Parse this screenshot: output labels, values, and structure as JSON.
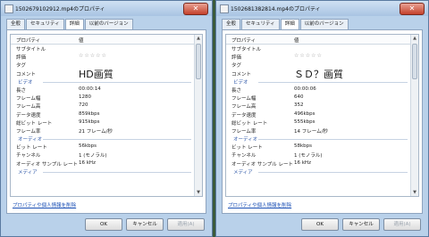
{
  "left_window": {
    "title": "1502679102912.mp4のプロパティ",
    "tabs": [
      "全般",
      "セキュリティ",
      "詳細",
      "以前のバージョン"
    ],
    "active_tab": 2,
    "header": {
      "prop": "プロパティ",
      "value": "値"
    },
    "desc_rows": [
      {
        "key": "サブタイトル",
        "value": ""
      },
      {
        "key": "評価",
        "value": "☆☆☆☆☆"
      },
      {
        "key": "タグ",
        "value": ""
      },
      {
        "key": "コメント",
        "value": "HD画質"
      }
    ],
    "video_section": "ビデオ",
    "video_rows": [
      {
        "key": "長さ",
        "value": "00:00:14"
      },
      {
        "key": "フレーム幅",
        "value": "1280"
      },
      {
        "key": "フレーム高",
        "value": "720"
      },
      {
        "key": "データ速度",
        "value": "859kbps"
      },
      {
        "key": "総ビット レート",
        "value": "915kbps"
      },
      {
        "key": "フレーム率",
        "value": "21 フレーム/秒"
      }
    ],
    "audio_section": "オーディオ",
    "audio_rows": [
      {
        "key": "ビット レート",
        "value": "56kbps"
      },
      {
        "key": "チャンネル",
        "value": "1 (モノラル)"
      },
      {
        "key": "オーディオ サンプル レート",
        "value": "16 kHz"
      }
    ],
    "media_section": "メディア",
    "link": "プロパティや個人情報を削除",
    "ok": "OK",
    "cancel": "キャンセル",
    "apply": "適用(A)"
  },
  "right_window": {
    "title": "1502681382814.mp4のプロパティ",
    "tabs": [
      "全般",
      "セキュリティ",
      "詳細",
      "以前のバージョン"
    ],
    "active_tab": 2,
    "header": {
      "prop": "プロパティ",
      "value": "値"
    },
    "desc_rows": [
      {
        "key": "サブタイトル",
        "value": ""
      },
      {
        "key": "評価",
        "value": "☆☆☆☆☆"
      },
      {
        "key": "タグ",
        "value": ""
      },
      {
        "key": "コメント",
        "value": "ＳＤ？画質"
      }
    ],
    "video_section": "ビデオ",
    "video_rows": [
      {
        "key": "長さ",
        "value": "00:00:06"
      },
      {
        "key": "フレーム幅",
        "value": "640"
      },
      {
        "key": "フレーム高",
        "value": "352"
      },
      {
        "key": "データ速度",
        "value": "496kbps"
      },
      {
        "key": "総ビット レート",
        "value": "555kbps"
      },
      {
        "key": "フレーム率",
        "value": "14 フレーム/秒"
      }
    ],
    "audio_section": "オーディオ",
    "audio_rows": [
      {
        "key": "ビット レート",
        "value": "58kbps"
      },
      {
        "key": "チャンネル",
        "value": "1 (モノラル)"
      },
      {
        "key": "オーディオ サンプル レート",
        "value": "16 kHz"
      }
    ],
    "media_section": "メディア",
    "link": "プロパティや個人情報を削除",
    "ok": "OK",
    "cancel": "キャンセル",
    "apply": "適用(A)"
  }
}
